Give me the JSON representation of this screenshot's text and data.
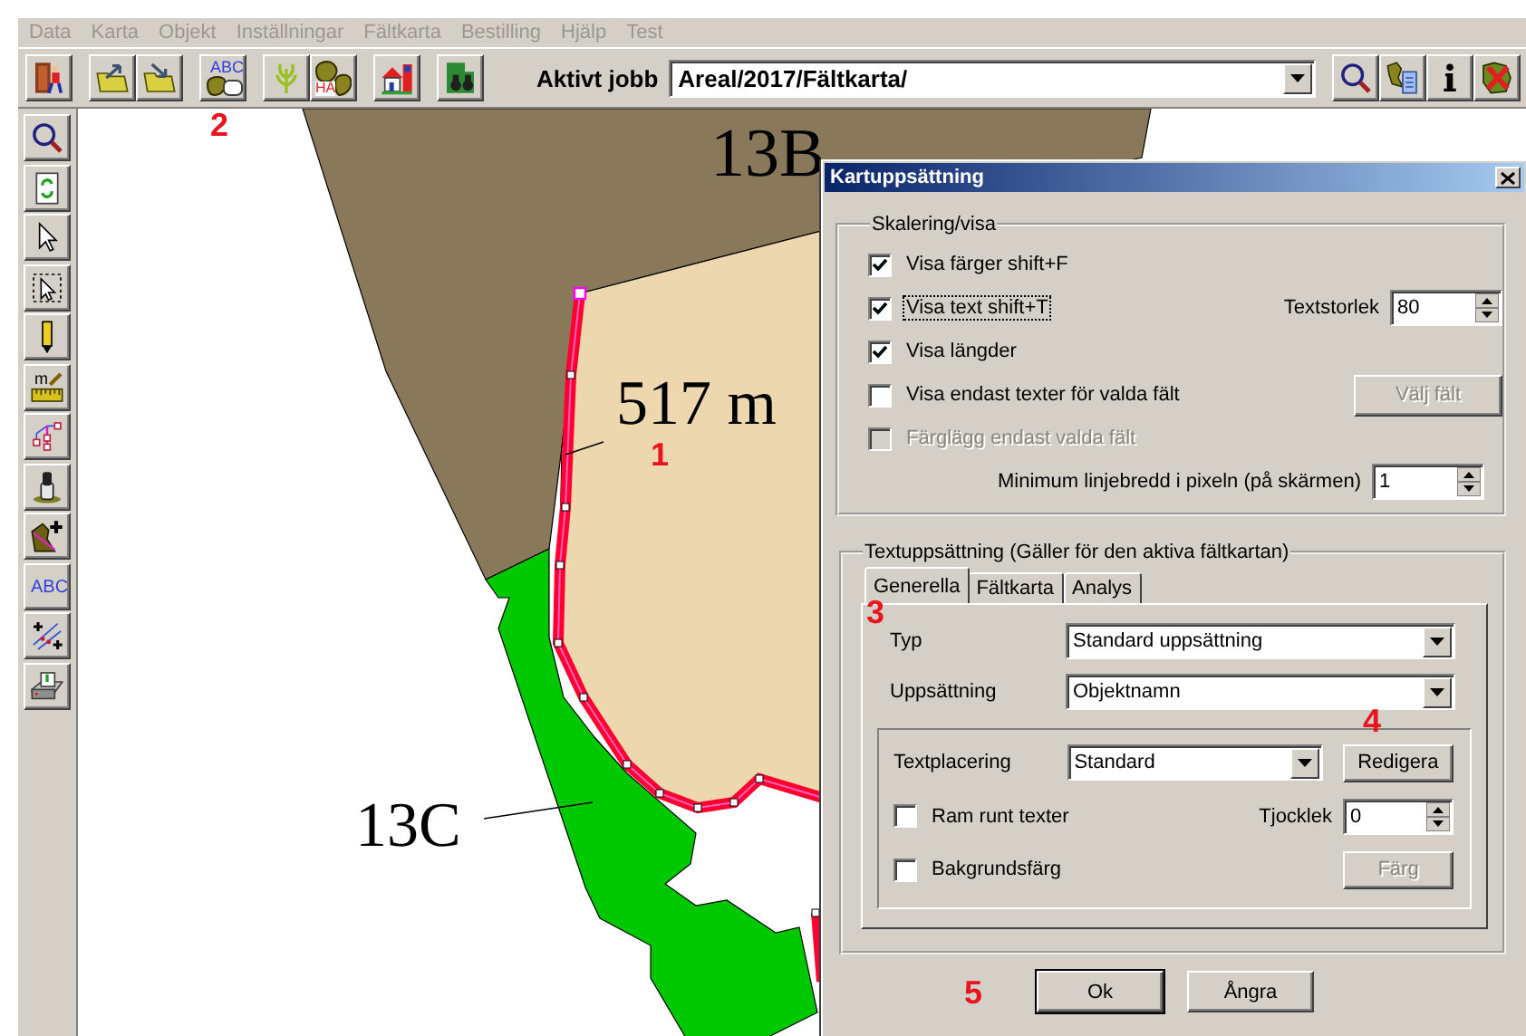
{
  "menu": [
    "Data",
    "Karta",
    "Objekt",
    "Inställningar",
    "Fältkarta",
    "Bestilling",
    "Hjälp",
    "Test"
  ],
  "toolbar": {
    "abc_icon_text": "ABC",
    "ha_icon_text": "HA",
    "job_label": "Aktivt jobb",
    "job_value": "Areal/2017/Fältkarta/"
  },
  "side_toolbar": {
    "ruler_icon_text": "m",
    "abc_icon_text": "ABC"
  },
  "map": {
    "labels": [
      "13B",
      "517 m",
      "13C"
    ]
  },
  "annotations": [
    "1",
    "2",
    "3",
    "4",
    "5"
  ],
  "dialog": {
    "title": "Kartuppsättning",
    "scaling": {
      "legend": "Skalering/visa",
      "options": [
        {
          "label": "Visa färger  shift+F",
          "checked": true,
          "disabled": false,
          "focused": false
        },
        {
          "label": "Visa text  shift+T",
          "checked": true,
          "disabled": false,
          "focused": true
        },
        {
          "label": "Visa längder",
          "checked": true,
          "disabled": false,
          "focused": false
        },
        {
          "label": "Visa endast texter för valda fält",
          "checked": false,
          "disabled": false,
          "focused": false
        },
        {
          "label": "Färglägg endast valda fält",
          "checked": false,
          "disabled": true,
          "focused": false
        }
      ],
      "text_size": {
        "label": "Textstorlek",
        "value": "80"
      },
      "choose_button": {
        "label": "Välj fält",
        "disabled": true
      },
      "min_width": {
        "label": "Minimum linjebredd i pixeln (på skärmen)",
        "value": "1"
      }
    },
    "text_setup": {
      "legend": "Textuppsättning  (Gäller för den aktiva fältkartan)",
      "tabs": [
        {
          "label": "Generella",
          "selected": true
        },
        {
          "label": "Fältkarta",
          "selected": false
        },
        {
          "label": "Analys",
          "selected": false
        }
      ],
      "type": {
        "label": "Typ",
        "value": "Standard uppsättning"
      },
      "setup": {
        "label": "Uppsättning",
        "value": "Objektnamn"
      },
      "placement": {
        "label": "Textplacering",
        "value": "Standard"
      },
      "edit_button": "Redigera",
      "frame": {
        "label": "Ram runt texter",
        "checked": false
      },
      "thickness": {
        "label": "Tjocklek",
        "value": "0"
      },
      "background": {
        "label": "Bakgrundsfärg",
        "checked": false
      },
      "color_button": {
        "label": "Färg",
        "disabled": true
      }
    },
    "buttons": [
      "Ok",
      "Ångra"
    ]
  }
}
